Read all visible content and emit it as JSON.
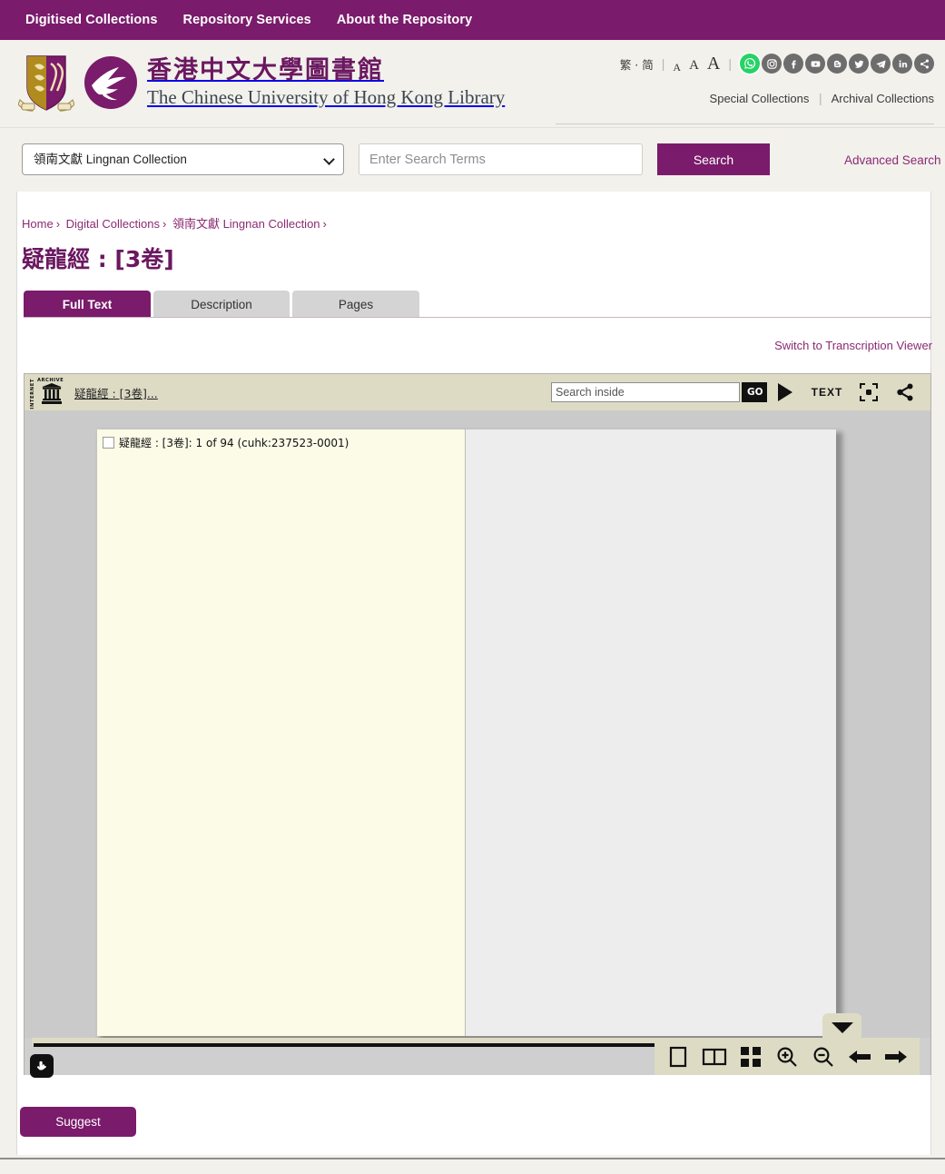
{
  "topnav": {
    "items": [
      {
        "label": "Digitised Collections"
      },
      {
        "label": "Repository Services"
      },
      {
        "label": "About the Repository"
      }
    ]
  },
  "header": {
    "brand_cn": "香港中文大學圖書館",
    "brand_en": "The Chinese University of Hong Kong Library",
    "lang_toggle": "繁 · 简",
    "font_sizes": [
      "A",
      "A",
      "A"
    ],
    "separator": "|",
    "socials": [
      {
        "name": "whatsapp-icon",
        "label": "WhatsApp"
      },
      {
        "name": "instagram-icon",
        "label": "Instagram"
      },
      {
        "name": "facebook-icon",
        "label": "Facebook"
      },
      {
        "name": "youtube-icon",
        "label": "YouTube"
      },
      {
        "name": "blogger-icon",
        "label": "Blogger"
      },
      {
        "name": "twitter-icon",
        "label": "Twitter"
      },
      {
        "name": "telegram-icon",
        "label": "Telegram"
      },
      {
        "name": "linkedin-icon",
        "label": "LinkedIn"
      },
      {
        "name": "share-icon",
        "label": "Share"
      }
    ],
    "special_collections": "Special Collections",
    "archival_collections": "Archival Collections"
  },
  "search": {
    "selected_collection": "領南文獻 Lingnan Collection",
    "options": [
      "領南文獻 Lingnan Collection"
    ],
    "placeholder": "Enter Search Terms",
    "value": "",
    "button_label": "Search",
    "advanced_label": "Advanced Search"
  },
  "breadcrumb": {
    "items": [
      {
        "label": "Home"
      },
      {
        "label": "Digital Collections"
      },
      {
        "label": "領南文獻 Lingnan Collection"
      }
    ],
    "separator": "›"
  },
  "page": {
    "title": "疑龍經 : [3卷]",
    "tabs": [
      {
        "label": "Full Text",
        "active": true
      },
      {
        "label": "Description",
        "active": false
      },
      {
        "label": "Pages",
        "active": false
      }
    ],
    "transcription_link": "Switch to Transcription Viewer",
    "suggest_label": "Suggest"
  },
  "bookreader": {
    "ia_internet": "INTERNET",
    "ia_archive": "ARCHIVE",
    "title": "疑龍經 : [3卷]...",
    "search_placeholder": "Search inside",
    "search_value": "",
    "go_label": "GO",
    "text_label": "TEXT",
    "page_label": "疑龍經 : [3卷]: 1 of 94 (cuhk:237523-0001)",
    "current_page": 1,
    "total_pages": 94,
    "identifier": "cuhk:237523-0001",
    "controls": [
      {
        "name": "one-page-view-icon"
      },
      {
        "name": "two-page-view-icon"
      },
      {
        "name": "thumbnail-view-icon"
      },
      {
        "name": "zoom-in-icon"
      },
      {
        "name": "zoom-out-icon"
      },
      {
        "name": "previous-page-icon"
      },
      {
        "name": "next-page-icon"
      }
    ]
  },
  "colors": {
    "brand_purple": "#7a1b6b",
    "link_purple": "#8b2a72",
    "page_bg": "#f2f1ec",
    "toolbar_beige": "#dedbc5",
    "stage_gray": "#cacaca"
  }
}
